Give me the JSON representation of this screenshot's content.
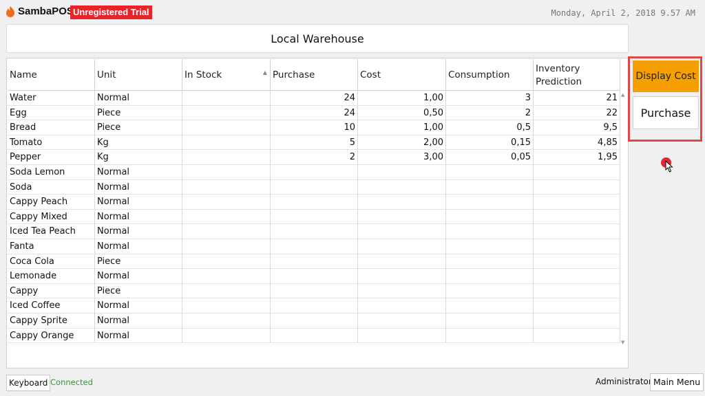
{
  "header": {
    "app_name": "SambaPOS",
    "badge": "Unregistered Trial",
    "datetime": "Monday, April 2, 2018 9.57 AM",
    "logo_icon": "flame-icon"
  },
  "warehouse_title": "Local Warehouse",
  "table": {
    "columns": [
      {
        "label": "Name"
      },
      {
        "label": "Unit"
      },
      {
        "label": "In Stock",
        "sort": "ascending"
      },
      {
        "label": "Purchase"
      },
      {
        "label": "Cost"
      },
      {
        "label": "Consumption"
      },
      {
        "label": "Inventory Prediction"
      }
    ],
    "rows": [
      [
        "Water",
        "Normal",
        "",
        "24",
        "1,00",
        "3",
        "21"
      ],
      [
        "Egg",
        "Piece",
        "",
        "24",
        "0,50",
        "2",
        "22"
      ],
      [
        "Bread",
        "Piece",
        "",
        "10",
        "1,00",
        "0,5",
        "9,5"
      ],
      [
        "Tomato",
        "Kg",
        "",
        "5",
        "2,00",
        "0,15",
        "4,85"
      ],
      [
        "Pepper",
        "Kg",
        "",
        "2",
        "3,00",
        "0,05",
        "1,95"
      ],
      [
        "Soda Lemon",
        "Normal",
        "",
        "",
        "",
        "",
        ""
      ],
      [
        "Soda",
        "Normal",
        "",
        "",
        "",
        "",
        ""
      ],
      [
        "Cappy Peach",
        "Normal",
        "",
        "",
        "",
        "",
        ""
      ],
      [
        "Cappy Mixed",
        "Normal",
        "",
        "",
        "",
        "",
        ""
      ],
      [
        "Iced Tea Peach",
        "Normal",
        "",
        "",
        "",
        "",
        ""
      ],
      [
        "Fanta",
        "Normal",
        "",
        "",
        "",
        "",
        ""
      ],
      [
        "Coca Cola",
        "Piece",
        "",
        "",
        "",
        "",
        ""
      ],
      [
        "Lemonade",
        "Normal",
        "",
        "",
        "",
        "",
        ""
      ],
      [
        "Cappy",
        "Piece",
        "",
        "",
        "",
        "",
        ""
      ],
      [
        "Iced Coffee",
        "Normal",
        "",
        "",
        "",
        "",
        ""
      ],
      [
        "Cappy Sprite",
        "Normal",
        "",
        "",
        "",
        "",
        ""
      ],
      [
        "Cappy Orange",
        "Normal",
        "",
        "",
        "",
        "",
        ""
      ]
    ]
  },
  "side_buttons": {
    "display_cost": "Display Cost",
    "purchase": "Purchase"
  },
  "footer": {
    "keyboard": "Keyboard",
    "status": "Connected",
    "user": "Administrator",
    "main_menu": "Main Menu"
  },
  "colors": {
    "accent": "#f59f00",
    "badge": "#e8232a",
    "highlight_border": "#e04848",
    "status_ok": "#3f8e3f"
  }
}
